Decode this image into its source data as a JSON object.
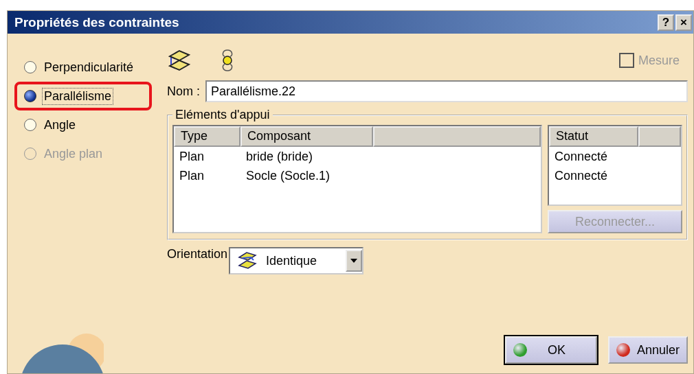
{
  "window": {
    "title": "Propriétés des contraintes",
    "help_button": "?",
    "close_button": "×"
  },
  "constraint_types": [
    {
      "label": "Perpendicularité",
      "selected": false,
      "disabled": false,
      "highlighted": false
    },
    {
      "label": "Parallélisme",
      "selected": true,
      "disabled": false,
      "highlighted": true
    },
    {
      "label": "Angle",
      "selected": false,
      "disabled": false,
      "highlighted": false
    },
    {
      "label": "Angle plan",
      "selected": false,
      "disabled": true,
      "highlighted": false
    }
  ],
  "measure": {
    "label": "Mesure",
    "checked": false,
    "disabled": true
  },
  "name_field": {
    "label": "Nom :",
    "value": "Parallélisme.22"
  },
  "support_group": {
    "title": "Eléments d'appui",
    "columns": [
      "Type",
      "Composant"
    ],
    "rows": [
      {
        "type": "Plan",
        "component": "bride (bride)"
      },
      {
        "type": "Plan",
        "component": "Socle (Socle.1)"
      }
    ],
    "status_column": "Statut",
    "statuses": [
      "Connecté",
      "Connecté"
    ],
    "reconnect_button": {
      "label": "Reconnecter...",
      "disabled": true
    }
  },
  "orientation": {
    "label": "Orientation",
    "value": "Identique"
  },
  "buttons": [
    {
      "label": "OK",
      "kind": "ok"
    },
    {
      "label": "Annuler",
      "kind": "cancel"
    }
  ]
}
